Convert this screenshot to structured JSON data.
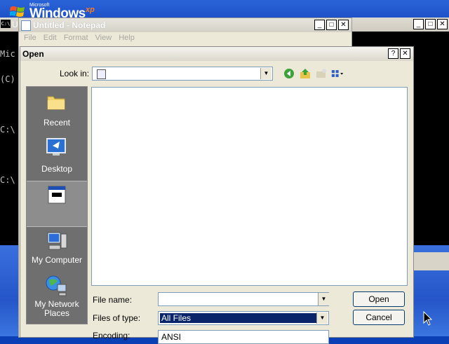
{
  "desktop": {
    "logo_ms": "Microsoft",
    "logo_windows": "Windows",
    "logo_xp": "xp"
  },
  "console": {
    "title_char": "U",
    "icon_text": "C:\\",
    "lines": [
      "Mic",
      "(C)",
      "",
      "C:\\",
      "",
      "C:\\"
    ]
  },
  "notepad": {
    "title": "Untitled - Notepad",
    "menu": [
      "File",
      "Edit",
      "Format",
      "View",
      "Help"
    ]
  },
  "dialog": {
    "title": "Open",
    "help_btn": "?",
    "close_btn": "✕",
    "lookin_label": "Look in:",
    "places": [
      {
        "label": "Recent",
        "icon": "recent-folder-icon"
      },
      {
        "label": "Desktop",
        "icon": "desktop-icon"
      },
      {
        "label": "",
        "icon": "my-documents-icon"
      },
      {
        "label": "My Computer",
        "icon": "my-computer-icon"
      },
      {
        "label": "My Network Places",
        "icon": "network-places-icon"
      }
    ],
    "filename_label": "File name:",
    "filename_value": "",
    "filetype_label": "Files of type:",
    "filetype_value": "All Files",
    "encoding_label": "Encoding:",
    "encoding_value": "ANSI",
    "open_label": "Open",
    "cancel_label": "Cancel"
  },
  "window_controls": {
    "minimize": "_",
    "maximize": "□",
    "close": "✕"
  }
}
